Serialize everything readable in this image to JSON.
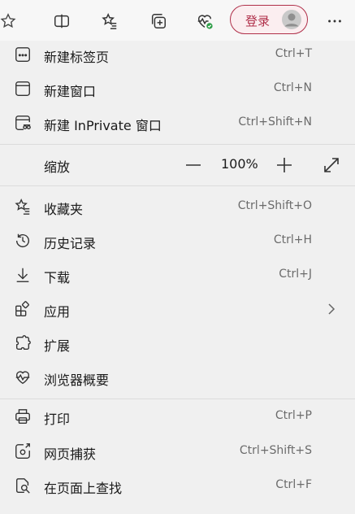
{
  "toolbar": {
    "icons": [
      "favorites-star-icon",
      "split-screen-icon",
      "favorites-list-icon",
      "collections-icon",
      "browser-essentials-icon",
      "more-icon"
    ],
    "login_label": "登录"
  },
  "menu": {
    "new_tab": {
      "label": "新建标签页",
      "shortcut": "Ctrl+T"
    },
    "new_window": {
      "label": "新建窗口",
      "shortcut": "Ctrl+N"
    },
    "new_inprivate": {
      "label": "新建 InPrivate 窗口",
      "shortcut": "Ctrl+Shift+N"
    },
    "zoom": {
      "label": "缩放",
      "value": "100%",
      "minus": "—",
      "plus": "+"
    },
    "favorites": {
      "label": "收藏夹",
      "shortcut": "Ctrl+Shift+O"
    },
    "history": {
      "label": "历史记录",
      "shortcut": "Ctrl+H"
    },
    "downloads": {
      "label": "下载",
      "shortcut": "Ctrl+J"
    },
    "apps": {
      "label": "应用"
    },
    "extensions": {
      "label": "扩展"
    },
    "essentials": {
      "label": "浏览器概要"
    },
    "print": {
      "label": "打印",
      "shortcut": "Ctrl+P"
    },
    "capture": {
      "label": "网页捕获",
      "shortcut": "Ctrl+Shift+S"
    },
    "find": {
      "label": "在页面上查找",
      "shortcut": "Ctrl+F"
    }
  },
  "colors": {
    "accent": "#b0304a",
    "health_badge": "#2e9e48"
  }
}
